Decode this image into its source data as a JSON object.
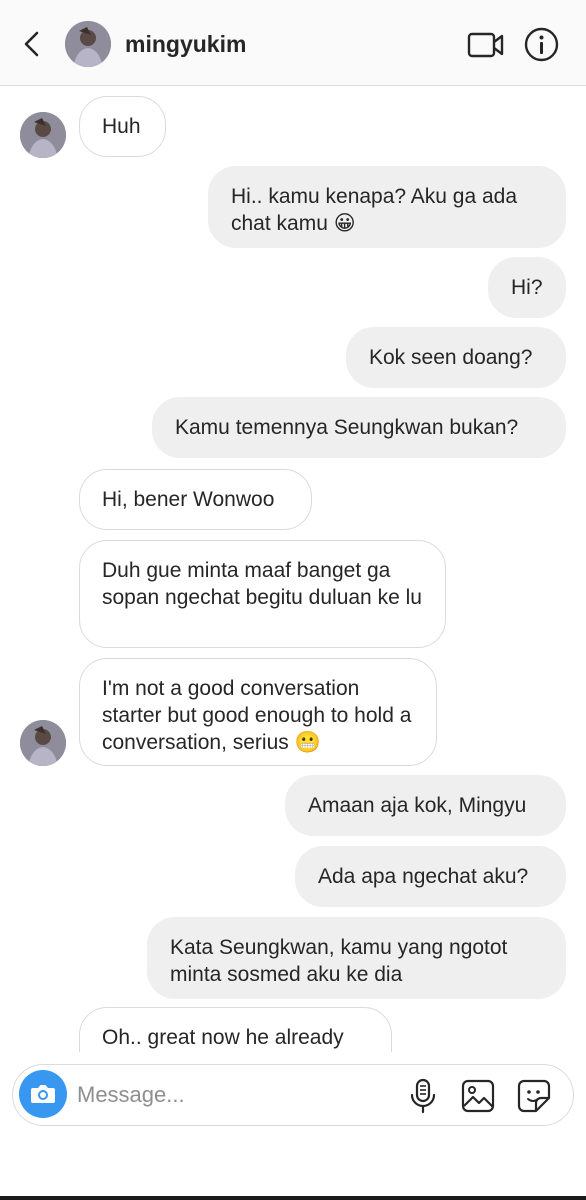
{
  "header": {
    "username": "mingyukim",
    "icons": {
      "back": "chevron-left-icon",
      "video": "video-camera-icon",
      "info": "info-icon"
    }
  },
  "messages": [
    {
      "sender": "them",
      "text": "Huh"
    },
    {
      "sender": "me",
      "text": "Hi.. kamu kenapa? Aku ga ada chat kamu 😀"
    },
    {
      "sender": "me",
      "text": "Hi?"
    },
    {
      "sender": "me",
      "text": "Kok seen doang?"
    },
    {
      "sender": "me",
      "text": "Kamu temennya Seungkwan bukan?"
    },
    {
      "sender": "them",
      "text": "Hi, bener Wonwoo"
    },
    {
      "sender": "them",
      "text": "Duh gue minta maaf banget ga sopan ngechat begitu duluan ke lu"
    },
    {
      "sender": "them",
      "text": "I'm not a good conversation starter but good enough to hold a conversation, serius 😬"
    },
    {
      "sender": "me",
      "text": "Amaan aja kok, Mingyu"
    },
    {
      "sender": "me",
      "text": "Ada apa ngechat aku?"
    },
    {
      "sender": "me",
      "text": "Kata Seungkwan, kamu yang ngotot minta sosmed aku ke dia"
    },
    {
      "sender": "them",
      "text": "Oh.. great now he already spilled everything"
    }
  ],
  "composer": {
    "placeholder": "Message...",
    "icons": {
      "camera": "camera-icon",
      "mic": "microphone-icon",
      "gallery": "gallery-icon",
      "sticker": "sticker-icon"
    }
  },
  "colors": {
    "accent": "#3897f0",
    "incoming_border": "#dbdbdb",
    "outgoing_bg": "#efefef"
  }
}
